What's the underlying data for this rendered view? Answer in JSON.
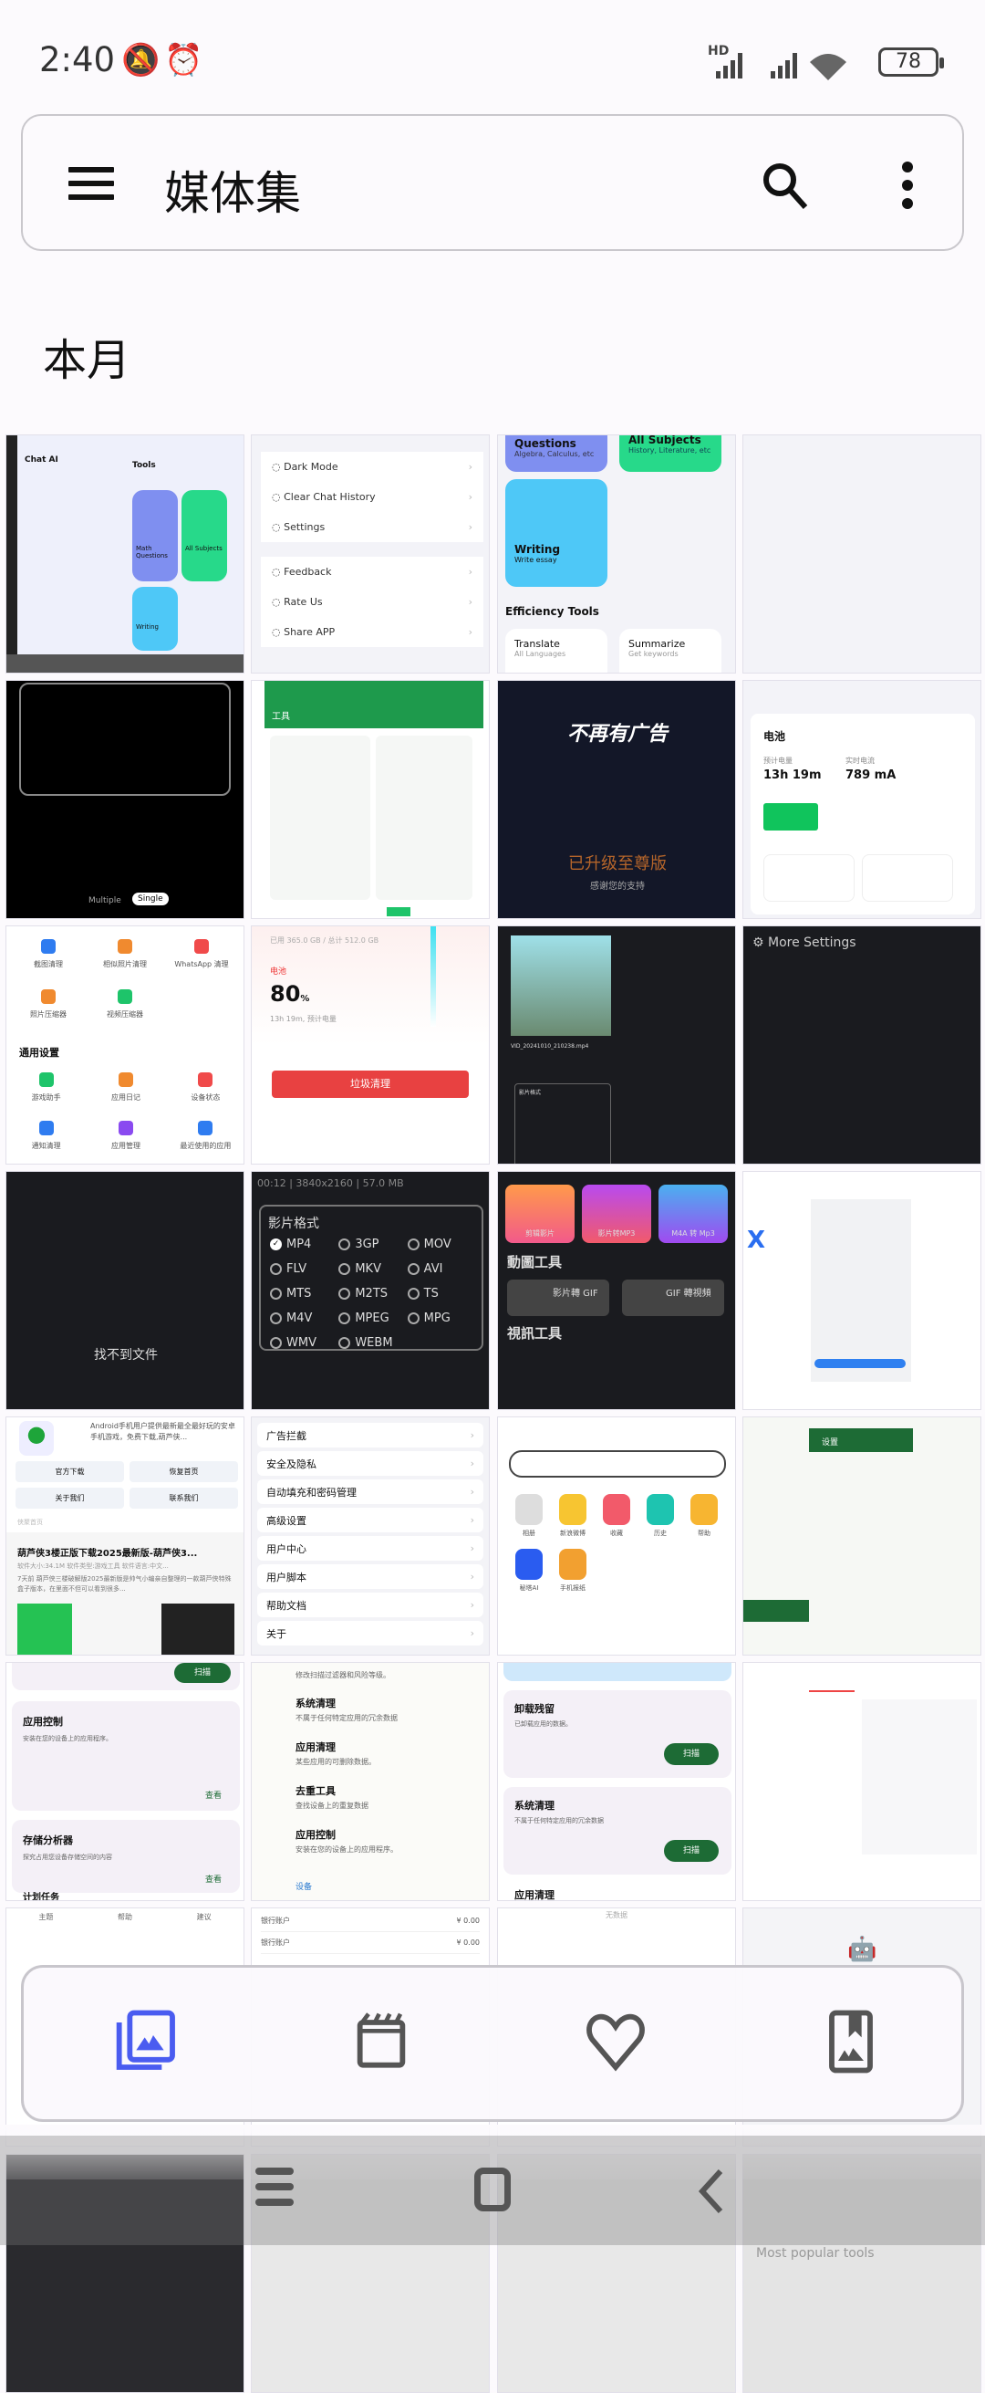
{
  "status": {
    "time": "2:40",
    "battery": "78",
    "network": "HD"
  },
  "appbar": {
    "title": "媒体集"
  },
  "section": {
    "title": "本月"
  },
  "thumbs": {
    "t1": {
      "app": "Chat AI",
      "tools": "Tools",
      "q": "Math Questions",
      "s": "All Subjects",
      "w": "Writing",
      "e": "Efficiency Tools",
      "tr": "Translate",
      "su": "Summarize"
    },
    "t2": {
      "items": [
        "Dark Mode",
        "Clear Chat History",
        "Settings",
        "Feedback",
        "Rate Us",
        "Share APP"
      ]
    },
    "t3": {
      "q": "Questions",
      "qs": "Algebra, Calculus, etc",
      "a": "All Subjects",
      "as": "History, Literature, etc",
      "w": "Writing",
      "ws": "Write essay",
      "e": "Efficiency Tools",
      "tr": "Translate",
      "trs": "All Languages",
      "su": "Summarize",
      "sus": "Get keywords"
    },
    "t5": {
      "multiple": "Multiple",
      "single": "Single"
    },
    "t6": {
      "title": "工具"
    },
    "t7": {
      "headline": "不再有广告",
      "upgraded": "已升级至尊版",
      "thanks": "感谢您的支持"
    },
    "t8": {
      "title": "电池",
      "est_label": "预计电量",
      "est": "13h 19m",
      "cur_label": "实时电流",
      "cur": "789 mA"
    },
    "t9": {
      "items": [
        "截图清理",
        "相似照片清理",
        "WhatsApp 清理",
        "照片压缩器",
        "视频压缩器"
      ],
      "section": "通用设置",
      "items2": [
        "游戏助手",
        "应用日记",
        "设备状态",
        "通知清理",
        "应用管理",
        "最近使用的应用"
      ]
    },
    "t10": {
      "storage": "已用 365.0 GB / 总计 512.0 GB",
      "battery": "电池",
      "pct": "80",
      "unit": "%",
      "est": "13h 19m, 预计电量",
      "button": "垃圾清理"
    },
    "t11": {
      "file": "VID_20241010_210238.mp4",
      "fmt": "影片格式"
    },
    "t12": {
      "title": "More Settings"
    },
    "t13": {
      "msg": "找不到文件"
    },
    "t14": {
      "info": "00:12 | 3840x2160 | 57.0 MB",
      "title": "影片格式",
      "formats": [
        "MP4",
        "3GP",
        "MOV",
        "FLV",
        "MKV",
        "AVI",
        "MTS",
        "M2TS",
        "TS",
        "M4V",
        "MPEG",
        "MPG",
        "WMV",
        "WEBM"
      ],
      "selected": "MP4"
    },
    "t15": {
      "tiles": [
        "剪辑影片",
        "影片转MP3",
        "M4A 转 Mp3"
      ],
      "gif": "動圖工具",
      "g1": "影片轉 GIF",
      "g2": "GIF 轉視頻",
      "video": "視訊工具"
    },
    "t17": {
      "desc": "Android手机用户提供最新最全最好玩的安卓手机游戏，免费下载,葫芦侠...",
      "btns": [
        "官方下载",
        "恢复首页",
        "关于我们",
        "联系我们"
      ],
      "home": "侠聚首页",
      "headline": "葫芦侠3楼正版下载2025最新版-葫芦侠3...",
      "meta": "软件大小:34.1M 软件类型:游戏工具 软件语言:中文...",
      "snippet": "7天前 葫芦侠三楼破解版2025最新版是帅气小编亲自整理的一款葫芦侠特殊盒子版本，在里面不但可以看到很多..."
    },
    "t18": {
      "items": [
        "广告拦截",
        "安全及隐私",
        "自动填充和密码管理",
        "高级设置",
        "用户中心",
        "用户脚本",
        "帮助文档",
        "关于"
      ]
    },
    "t19": {
      "apps": [
        "相册",
        "新浪微博",
        "收藏",
        "历史",
        "帮助",
        "秘塔AI",
        "手机报纸"
      ]
    },
    "t20": {
      "title": "设置"
    },
    "t21": {
      "scan": "扫描",
      "c1": "应用控制",
      "c1s": "安装在您的设备上的应用程序。",
      "view": "查看",
      "c2": "存储分析器",
      "c2s": "探究占用您设备存储空间的内容",
      "c3": "计划任务"
    },
    "t22": {
      "top": "修改扫描过滤器和风险等级。",
      "items": [
        [
          "系统清理",
          "不属于任何特定应用的冗余数据"
        ],
        [
          "应用清理",
          "某些应用的可删除数据。"
        ],
        [
          "去重工具",
          "查找设备上的重复数据"
        ],
        [
          "应用控制",
          "安装在您的设备上的应用程序。"
        ]
      ],
      "foot": "设备"
    },
    "t23": {
      "c1": "卸载残留",
      "c1s": "已卸载应用的数据。",
      "scan": "扫描",
      "c2": "系统清理",
      "c2s": "不属于任何特定应用的冗余数据",
      "c3": "应用清理"
    },
    "t25": {
      "tabs": [
        "主题",
        "帮助",
        "建议"
      ]
    },
    "t26": {
      "rows": [
        [
          "银行账户",
          "¥ 0.00"
        ],
        [
          "银行账户",
          "¥ 0.00"
        ]
      ]
    },
    "t27": {
      "msg": "无数据"
    },
    "t32": {
      "title": "Most popular tools"
    }
  },
  "bottom_nav": {
    "items": [
      {
        "icon": "photos-icon",
        "active": true
      },
      {
        "icon": "videos-icon"
      },
      {
        "icon": "favorites-icon"
      },
      {
        "icon": "album-icon"
      }
    ],
    "accent": "#4a5cf0"
  }
}
